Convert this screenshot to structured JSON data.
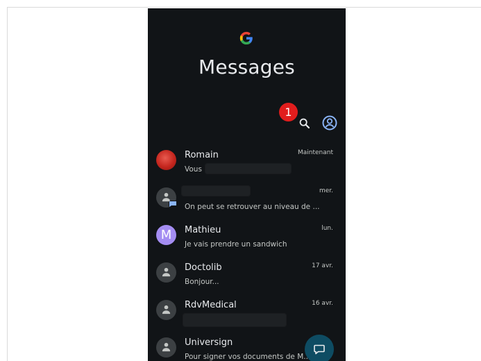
{
  "app": {
    "title": "Messages"
  },
  "annotation": {
    "badge_number": "1"
  },
  "colors": {
    "background": "#111417",
    "text_primary": "#e8eaed",
    "text_secondary": "#c4c7c5",
    "badge_red": "#e11d1d",
    "avatar_purple": "#a48df2",
    "fab": "#0e4c63",
    "accent_icon": "#8ab4f8"
  },
  "icons": {
    "logo": "google-g-logo",
    "search": "search-icon",
    "account": "account-circle-icon",
    "fab": "start-chat-icon"
  },
  "conversations": [
    {
      "name": "Romain",
      "time": "Maintenant",
      "snippet": "Vous",
      "avatar": "photo"
    },
    {
      "name": "",
      "time": "mer.",
      "snippet": "On peut se retrouver au niveau de ...",
      "avatar": "person"
    },
    {
      "name": "Mathieu",
      "time": "lun.",
      "snippet": "Je vais prendre un sandwich",
      "avatar": "M"
    },
    {
      "name": "Doctolib",
      "time": "17 avr.",
      "snippet": "Bonjour...",
      "avatar": "person"
    },
    {
      "name": "RdvMedical",
      "time": "16 avr.",
      "snippet": "",
      "avatar": "person"
    },
    {
      "name": "Universign",
      "time": "",
      "snippet": "Pour signer vos documents de M...",
      "avatar": "person"
    }
  ]
}
